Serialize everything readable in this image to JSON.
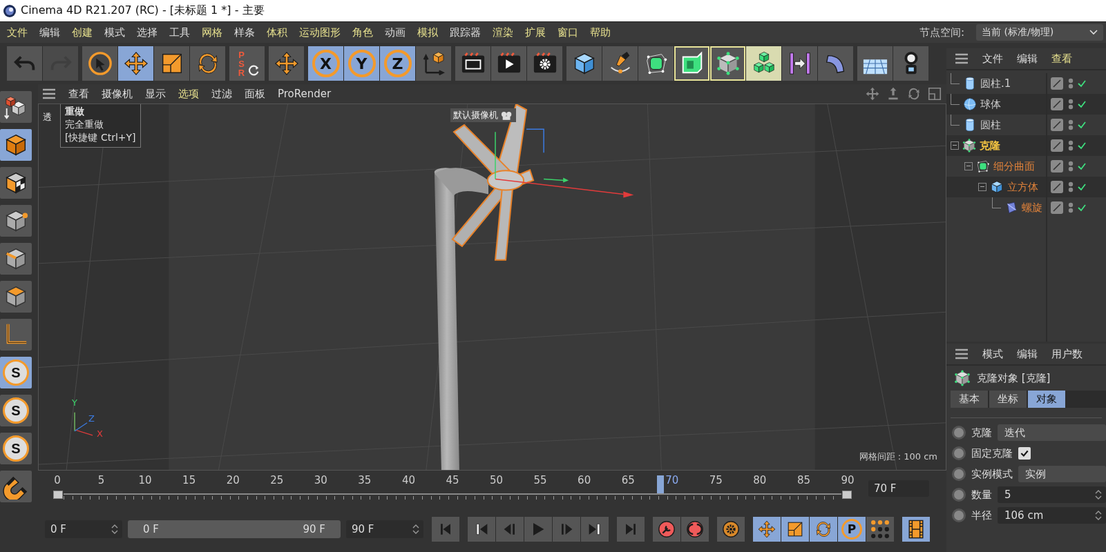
{
  "window": {
    "title": "Cinema 4D R21.207 (RC) - [未标题 1 *] - 主要"
  },
  "menu": [
    {
      "label": "文件",
      "highlighted": true
    },
    {
      "label": "编辑",
      "highlighted": false
    },
    {
      "label": "创建",
      "highlighted": true
    },
    {
      "label": "模式",
      "highlighted": false
    },
    {
      "label": "选择",
      "highlighted": false
    },
    {
      "label": "工具",
      "highlighted": false
    },
    {
      "label": "网格",
      "highlighted": true
    },
    {
      "label": "样条",
      "highlighted": false
    },
    {
      "label": "体积",
      "highlighted": true
    },
    {
      "label": "运动图形",
      "highlighted": true
    },
    {
      "label": "角色",
      "highlighted": true
    },
    {
      "label": "动画",
      "highlighted": false
    },
    {
      "label": "模拟",
      "highlighted": true
    },
    {
      "label": "跟踪器",
      "highlighted": false
    },
    {
      "label": "渲染",
      "highlighted": true
    },
    {
      "label": "扩展",
      "highlighted": true
    },
    {
      "label": "窗口",
      "highlighted": true
    },
    {
      "label": "帮助",
      "highlighted": true
    }
  ],
  "node_space": {
    "label": "节点空间:",
    "value": "当前 (标准/物理)"
  },
  "toolbar": [
    {
      "buttons": [
        {
          "kind": "undo",
          "selected": false
        },
        {
          "kind": "redo",
          "selected": false,
          "disabled": true
        }
      ]
    },
    {
      "buttons": [
        {
          "kind": "select",
          "selected": false
        },
        {
          "kind": "move",
          "selected": true
        },
        {
          "kind": "scale",
          "selected": false
        },
        {
          "kind": "rotate",
          "selected": false
        }
      ]
    },
    {
      "buttons": [
        {
          "kind": "psr",
          "label": "PSR",
          "selected": false
        }
      ]
    },
    {
      "buttons": [
        {
          "kind": "move",
          "selected": false
        }
      ]
    },
    {
      "buttons": [
        {
          "kind": "lock",
          "label": "X",
          "selected": true
        },
        {
          "kind": "lock",
          "label": "Y",
          "selected": true
        },
        {
          "kind": "lock",
          "label": "Z",
          "selected": true
        },
        {
          "kind": "coord",
          "selected": false
        }
      ]
    },
    {
      "buttons": [
        {
          "kind": "clapper",
          "selected": false
        },
        {
          "kind": "render",
          "selected": false
        },
        {
          "kind": "render-settings",
          "selected": false
        }
      ]
    },
    {
      "buttons": [
        {
          "kind": "cube",
          "selected": false
        },
        {
          "kind": "pen",
          "selected": false
        },
        {
          "kind": "subdiv",
          "selected": false
        },
        {
          "kind": "extrude",
          "selected": false,
          "highlighted": true
        },
        {
          "kind": "cloner",
          "selected": false,
          "highlighted": true
        },
        {
          "kind": "cubes",
          "selected": true,
          "highlighted": true
        },
        {
          "kind": "mirror",
          "selected": false
        },
        {
          "kind": "bend",
          "selected": false
        }
      ]
    },
    {
      "buttons": [
        {
          "kind": "floor",
          "selected": false
        },
        {
          "kind": "camera",
          "selected": false
        }
      ]
    }
  ],
  "left_toolbar": [
    {
      "kind": "model",
      "selected": false
    },
    {
      "kind": "cube-mode",
      "selected": true
    },
    {
      "kind": "texture",
      "selected": false
    },
    {
      "kind": "points",
      "selected": false
    },
    {
      "kind": "edges",
      "selected": false
    },
    {
      "kind": "polygons",
      "selected": false
    },
    {
      "kind": "axis",
      "selected": false
    },
    {
      "kind": "snap",
      "label": "S",
      "selected": true
    },
    {
      "kind": "snap",
      "label": "S",
      "selected": false
    },
    {
      "kind": "snap",
      "label": "S",
      "selected": false
    },
    {
      "kind": "magnet",
      "selected": false
    }
  ],
  "viewport": {
    "menu": [
      {
        "label": "查看",
        "highlighted": false
      },
      {
        "label": "摄像机",
        "highlighted": false
      },
      {
        "label": "显示",
        "highlighted": false
      },
      {
        "label": "选项",
        "highlighted": true
      },
      {
        "label": "过滤",
        "highlighted": false
      },
      {
        "label": "面板",
        "highlighted": false
      },
      {
        "label": "ProRender",
        "highlighted": false
      }
    ],
    "view_label": "透",
    "camera_label": "默认摄像机",
    "grid_info": "网格间距 : 100 cm",
    "axis_labels": [
      "Y",
      "Z",
      "X"
    ]
  },
  "tooltip": {
    "title": "重做",
    "description": "完全重做",
    "shortcut": "[快捷键 Ctrl+Y]"
  },
  "object_manager": {
    "menu": [
      {
        "label": "文件",
        "highlighted": false
      },
      {
        "label": "编辑",
        "highlighted": false
      },
      {
        "label": "查看",
        "highlighted": true
      }
    ],
    "objects": [
      {
        "name": "圆柱.1",
        "kind": "cylinder",
        "selected": false,
        "visible": true
      },
      {
        "name": "球体",
        "kind": "sphere",
        "selected": false,
        "visible": true
      },
      {
        "name": "圆柱",
        "kind": "cylinder",
        "selected": false,
        "visible": true
      },
      {
        "name": "克隆",
        "kind": "cloner",
        "selected": true,
        "visible": true,
        "expanded": true,
        "children": [
          {
            "name": "细分曲面",
            "kind": "subdiv",
            "selected": false,
            "visible": true,
            "expanded": true,
            "children": [
              {
                "name": "立方体",
                "kind": "cube",
                "selected": false,
                "visible": true,
                "expanded": true,
                "children": [
                  {
                    "name": "螺旋",
                    "kind": "twist",
                    "selected": false,
                    "visible": true
                  }
                ]
              }
            ]
          }
        ]
      }
    ]
  },
  "attributes": {
    "menu": [
      "模式",
      "编辑",
      "用户数"
    ],
    "title": "克隆对象 [克隆]",
    "tabs": [
      {
        "label": "基本",
        "selected": false
      },
      {
        "label": "坐标",
        "selected": false
      },
      {
        "label": "对象",
        "selected": true
      }
    ],
    "params": [
      {
        "kind": "dropdown",
        "label": "克隆",
        "value": "迭代",
        "animated": false
      },
      {
        "kind": "checkbox",
        "label": "固定克隆",
        "checked": true,
        "animated": false
      },
      {
        "kind": "dropdown",
        "label": "实例模式",
        "value": "实例",
        "animated": false
      },
      {
        "kind": "number",
        "label": "数量",
        "value": "5",
        "animated": false
      },
      {
        "kind": "number",
        "label": "半径",
        "value": "106 cm",
        "animated": false
      }
    ]
  },
  "timeline": {
    "ticks": [
      "0",
      "5",
      "10",
      "15",
      "20",
      "25",
      "30",
      "35",
      "40",
      "45",
      "50",
      "55",
      "60",
      "65",
      "70",
      "75",
      "80",
      "85",
      "90"
    ],
    "level": 0.7778,
    "current_frame": "70 F"
  },
  "controls": {
    "start_field": "0 F",
    "range": {
      "start": "0 F",
      "end": "90 F",
      "level": 1
    },
    "end_field": "90 F",
    "groups": [
      {
        "buttons": [
          {
            "kind": "first",
            "selected": false
          }
        ]
      },
      {
        "buttons": [
          {
            "kind": "prev-key",
            "selected": false
          },
          {
            "kind": "prev-frame",
            "selected": false
          },
          {
            "kind": "play",
            "selected": false
          },
          {
            "kind": "next-frame",
            "selected": false
          },
          {
            "kind": "next-key",
            "selected": false
          }
        ]
      },
      {
        "buttons": [
          {
            "kind": "last",
            "selected": false
          }
        ]
      },
      {
        "buttons": [
          {
            "kind": "record",
            "selected": false
          },
          {
            "kind": "autokey",
            "selected": false
          }
        ]
      },
      {
        "buttons": [
          {
            "kind": "key-settings",
            "selected": false
          }
        ]
      },
      {
        "buttons": [
          {
            "kind": "move",
            "selected": true
          },
          {
            "kind": "scale",
            "selected": true
          },
          {
            "kind": "rotate",
            "selected": true
          },
          {
            "kind": "lock",
            "label": "P",
            "selected": true
          },
          {
            "kind": "dots",
            "selected": false
          }
        ]
      },
      {
        "buttons": [
          {
            "kind": "film",
            "selected": true
          }
        ]
      }
    ]
  }
}
